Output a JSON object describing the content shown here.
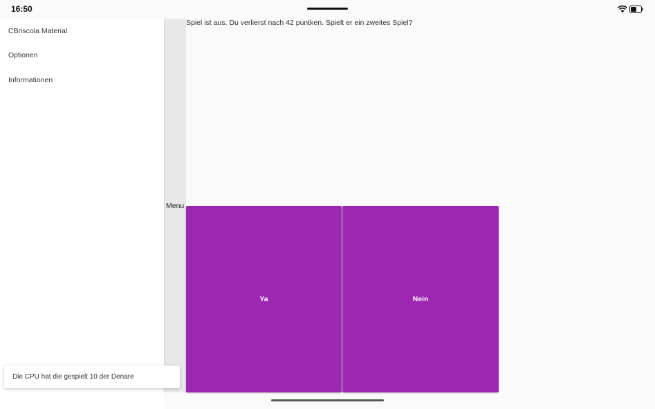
{
  "status_bar": {
    "time": "16:50"
  },
  "drawer": {
    "items": [
      {
        "label": "CBriscola Material"
      },
      {
        "label": "Optionen"
      },
      {
        "label": "Informationen"
      }
    ]
  },
  "menu_strip": {
    "label": "Menu"
  },
  "game": {
    "message": "Spiel ist aus. Du verlierst nach 42 puntken. Spielt er ein zweites Spiel?",
    "yes_label": "Ya",
    "no_label": "Nein"
  },
  "snackbar": {
    "text": "Die CPU hat die gespielt 10 der Denare"
  },
  "colors": {
    "accent": "#9c27b0",
    "background": "#fafafa",
    "drawer": "#ffffff",
    "menu_strip": "#e8e8e8"
  },
  "icons": {
    "wifi": "wifi-icon",
    "battery": "battery-icon"
  }
}
